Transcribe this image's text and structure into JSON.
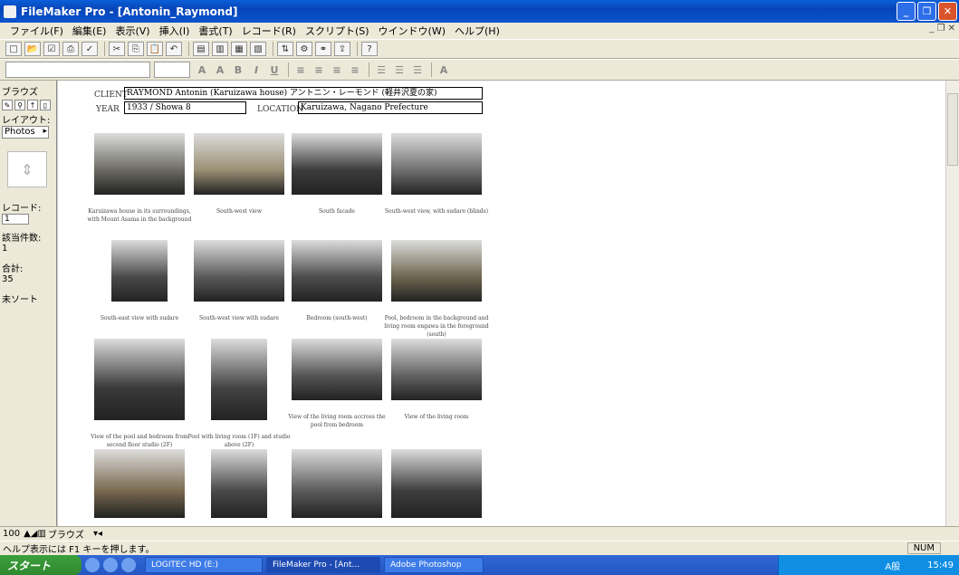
{
  "window": {
    "title": "FileMaker Pro - [Antonin_Raymond]"
  },
  "menu": [
    "ファイル(F)",
    "編集(E)",
    "表示(V)",
    "挿入(I)",
    "書式(T)",
    "レコード(R)",
    "スクリプト(S)",
    "ウインドウ(W)",
    "ヘルプ(H)"
  ],
  "sidebar": {
    "mode": "ブラウズ",
    "layout_label": "レイアウト:",
    "layout_value": "Photos",
    "record_label": "レコード:",
    "record_value": "1",
    "found_label": "該当件数:",
    "found_value": "1",
    "total_label": "合計:",
    "total_value": "35",
    "sort_label": "未ソート"
  },
  "record": {
    "client_label": "CLIENT",
    "client_value": "RAYMOND Antonin (Karuizawa house)  アントニン・レーモンド (軽井沢夏の家)",
    "year_label": "YEAR",
    "year_value": "1933 / Showa 8",
    "location_label": "LOCATION",
    "location_value": "Karuizawa, Nagano Prefecture"
  },
  "photos": [
    {
      "caption": "Karuizawa house in its surroundings, with Mount Asama in the background"
    },
    {
      "caption": "South-west view"
    },
    {
      "caption": "South facade"
    },
    {
      "caption": "South-west view, with sudare (blinds)"
    },
    {
      "caption": "South-east view with sudare"
    },
    {
      "caption": "South-west view with sudare"
    },
    {
      "caption": "Bedroom (south-west)"
    },
    {
      "caption": "Pool, bedroom in the background and living room engawa in the foreground (south)"
    },
    {
      "caption": "View of the pool and bedroom from second floor studio (2F)"
    },
    {
      "caption": "Pool with living room (1F) and studio above (2F)"
    },
    {
      "caption": "View of the living room accross the pool from bedroom"
    },
    {
      "caption": "View of the living room"
    },
    {
      "caption": ""
    },
    {
      "caption": ""
    },
    {
      "caption": ""
    },
    {
      "caption": ""
    }
  ],
  "bottom": {
    "zoom": "100",
    "mode": "ブラウズ"
  },
  "status": {
    "help": "ヘルプ表示には F1 キーを押します。",
    "num": "NUM"
  },
  "taskbar": {
    "start": "スタート",
    "apps": [
      "LOGITEC HD (E:)",
      "FileMaker Pro - [Ant...",
      "Adobe Photoshop"
    ],
    "clock": "15:49",
    "ime": "A般"
  }
}
